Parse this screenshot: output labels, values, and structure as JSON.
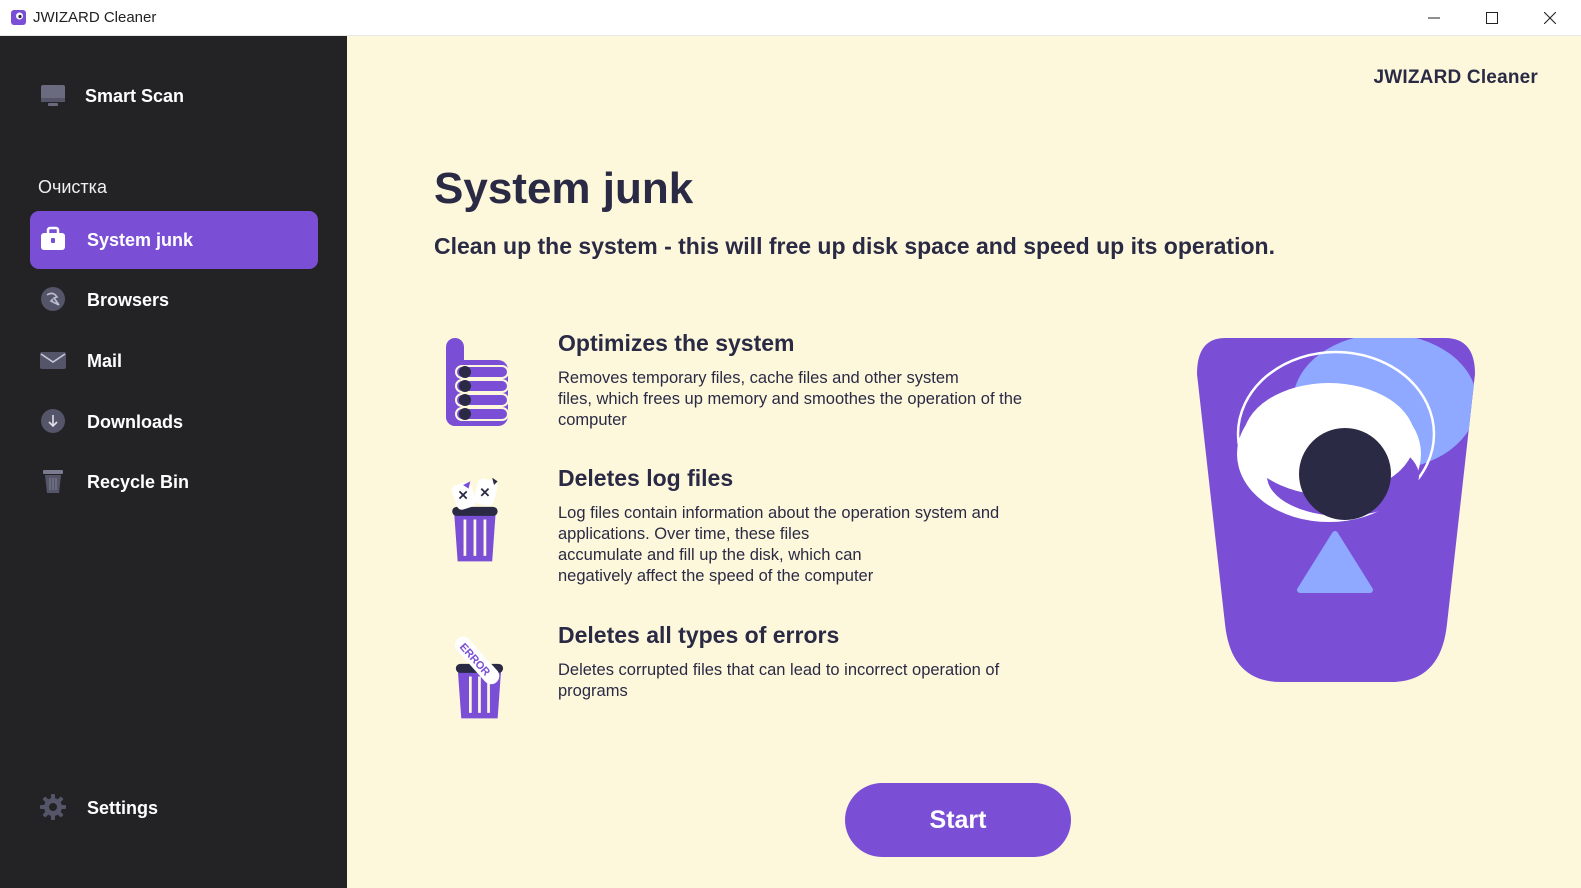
{
  "window": {
    "title": "JWIZARD Cleaner",
    "controls": {
      "minimize": "minimize-icon",
      "maximize": "maximize-icon",
      "close": "close-icon"
    }
  },
  "sidebar": {
    "smart_scan": {
      "label": "Smart Scan",
      "icon": "monitor-icon"
    },
    "section_title": "Очистка",
    "items": [
      {
        "label": "System junk",
        "icon": "briefcase-icon",
        "active": true
      },
      {
        "label": "Browsers",
        "icon": "browser-icon",
        "active": false
      },
      {
        "label": "Mail",
        "icon": "mail-icon",
        "active": false
      },
      {
        "label": "Downloads",
        "icon": "download-icon",
        "active": false
      },
      {
        "label": "Recycle Bin",
        "icon": "trash-icon",
        "active": false
      }
    ],
    "settings": {
      "label": "Settings",
      "icon": "gear-icon"
    }
  },
  "main": {
    "brand": "JWIZARD Cleaner",
    "title": "System junk",
    "subtitle": "Clean up the system - this will free up disk space and speed up its operation.",
    "features": [
      {
        "title": "Optimizes the system",
        "description_lines": [
          "Removes temporary files, cache files and other system",
          "files, which frees up memory and smoothes the operation of the",
          "computer"
        ],
        "icon": "thumbs-up-icon"
      },
      {
        "title": "Deletes log files",
        "description_lines": [
          "Log files contain information about the operation system and",
          "applications. Over time, these files",
          "accumulate and fill up the disk, which can",
          "negatively affect the speed of the computer"
        ],
        "icon": "broken-files-bin-icon"
      },
      {
        "title": "Deletes all types of errors",
        "description_lines": [
          "Deletes corrupted files that can lead to incorrect operation of",
          "programs"
        ],
        "icon": "error-bin-icon",
        "icon_text": "ERROR"
      }
    ],
    "start_label": "Start",
    "illustration": "trash-bin-eye-illustration"
  },
  "colors": {
    "accent": "#7a4fd6",
    "sidebar_bg": "#232326",
    "main_bg": "#fdf8dc",
    "text_dark": "#2a2a44",
    "light_blue": "#8ea9ff"
  }
}
